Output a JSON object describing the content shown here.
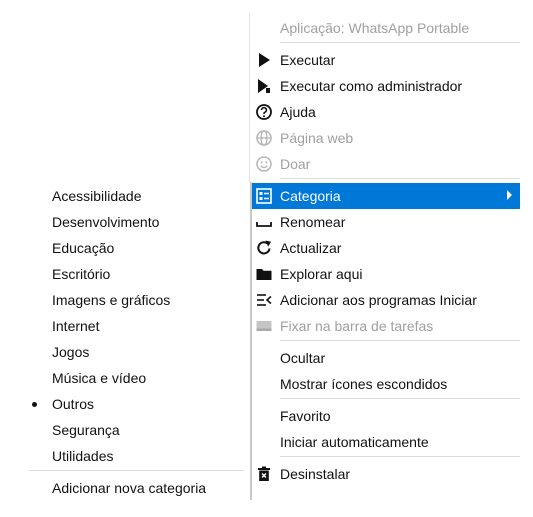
{
  "context_menu": {
    "header": "Aplicação: WhatsApp Portable",
    "items": [
      {
        "label": "Executar",
        "icon": "play-icon",
        "disabled": false
      },
      {
        "label": "Executar como administrador",
        "icon": "run-as-admin-icon",
        "disabled": false
      },
      {
        "label": "Ajuda",
        "icon": "help-icon",
        "disabled": false
      },
      {
        "label": "Página web",
        "icon": "globe-icon",
        "disabled": true
      },
      {
        "label": "Doar",
        "icon": "smiley-icon",
        "disabled": true
      },
      {
        "label": "Categoria",
        "icon": "category-icon",
        "selected": true,
        "has_submenu": true
      },
      {
        "label": "Renomear",
        "icon": "rename-icon",
        "disabled": false
      },
      {
        "label": "Actualizar",
        "icon": "refresh-icon",
        "disabled": false
      },
      {
        "label": "Explorar aqui",
        "icon": "folder-icon",
        "disabled": false
      },
      {
        "label": "Adicionar aos programas Iniciar",
        "icon": "add-to-start-icon",
        "disabled": false
      },
      {
        "label": "Fixar na barra de tarefas",
        "icon": "taskbar-icon",
        "disabled": true
      },
      {
        "label": "Ocultar",
        "disabled": false
      },
      {
        "label": "Mostrar ícones escondidos",
        "disabled": false
      },
      {
        "label": "Favorito",
        "disabled": false
      },
      {
        "label": "Iniciar automaticamente",
        "disabled": false
      },
      {
        "label": "Desinstalar",
        "icon": "trash-icon",
        "disabled": false
      }
    ]
  },
  "category_submenu": {
    "items": [
      {
        "label": "Acessibilidade"
      },
      {
        "label": "Desenvolvimento"
      },
      {
        "label": "Educação"
      },
      {
        "label": "Escritório"
      },
      {
        "label": "Imagens e gráficos"
      },
      {
        "label": "Internet"
      },
      {
        "label": "Jogos"
      },
      {
        "label": "Música e vídeo"
      },
      {
        "label": "Outros",
        "checked": true
      },
      {
        "label": "Segurança"
      },
      {
        "label": "Utilidades"
      }
    ],
    "add_label": "Adicionar nova categoria"
  },
  "colors": {
    "selection": "#0078d7",
    "disabled_text": "#a0a0a0",
    "separator": "#dcdcdc"
  }
}
